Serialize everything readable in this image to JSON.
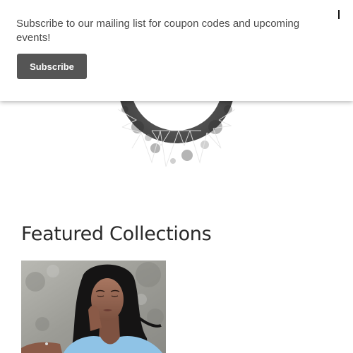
{
  "popup": {
    "message": "Subscribe to our mailing list for coupon codes and upcoming events!",
    "subscribe_label": "Subscribe",
    "close_icon": "close-icon"
  },
  "logo": {
    "icon": "crescent-moon-logo",
    "color": "#555555"
  },
  "featured": {
    "title": "Featured Collections",
    "collections": [
      {
        "image": "woman-in-blue-top-photo"
      }
    ]
  },
  "colors": {
    "button_bg": "#555555",
    "button_text": "#ffffff",
    "text": "#4a4a4a",
    "heading": "#2a2a2a"
  }
}
